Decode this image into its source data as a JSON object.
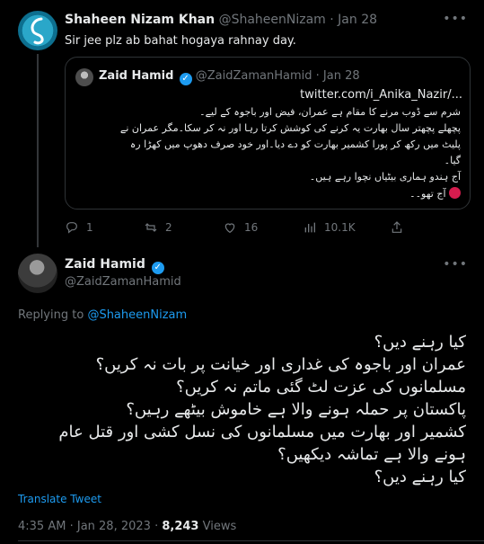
{
  "parent_tweet": {
    "author_name": "Shaheen Nizam Khan",
    "handle": "@ShaheenNizam",
    "separator": "·",
    "date": "Jan 28",
    "text": "Sir jee plz ab bahat hogaya rahnay day.",
    "more_icon": "ellipsis-icon",
    "quoted": {
      "author_name": "Zaid Hamid",
      "handle": "@ZaidZamanHamid",
      "separator": "·",
      "date": "Jan 28",
      "link": "twitter.com/i_Anika_Nazir/...",
      "lines": [
        "شرم سے ڈوب مرنے کا مقام ہے عمران، فیض اور باجوہ کے لیے۔",
        "پچھلے پچھتر سال بھارت یہ کرنے کی کوشش کرتا رہا اور نہ کر سکا۔مگر عمران نے",
        "پلیٹ میں رکھ کر پورا کشمیر بھارت کو دے دیا۔اور خود صرف دھوپ میں کھڑا رہ",
        "گیا۔",
        "آج ہندو ہماری بیٹیاں نچوا رہے ہیں۔",
        "آج تھو۔۔"
      ],
      "emoji": "angry-face-icon"
    },
    "actions": {
      "replies": "1",
      "retweets": "2",
      "likes": "16",
      "views": "10.1K"
    }
  },
  "main_tweet": {
    "author_name": "Zaid Hamid",
    "handle": "@ZaidZamanHamid",
    "replying_prefix": "Replying to",
    "replying_to": "@ShaheenNizam",
    "lines": [
      "کیا رہنے دیں؟",
      "عمران اور باجوہ کی غداری اور خیانت پر بات نہ کریں؟",
      "مسلمانوں کی عزت لٹ گئی ماتم نہ کریں؟",
      "پاکستان پر حملہ ہونے والا ہے خاموش بیٹھے رہیں؟",
      "کشمیر اور بھارت میں مسلمانوں کی نسل کشی اور قتل عام",
      "ہونے والا ہے تماشہ دیکھیں؟",
      "کیا رہنے دیں؟"
    ],
    "translate_label": "Translate Tweet",
    "time": "4:35 AM",
    "separator": "·",
    "date": "Jan 28, 2023",
    "separator2": "·",
    "views_count": "8,243",
    "views_label": "Views"
  },
  "colors": {
    "background": "#000000",
    "text": "#e7e9ea",
    "muted": "#71767b",
    "link": "#1d9bf0",
    "border": "#2f3336"
  }
}
